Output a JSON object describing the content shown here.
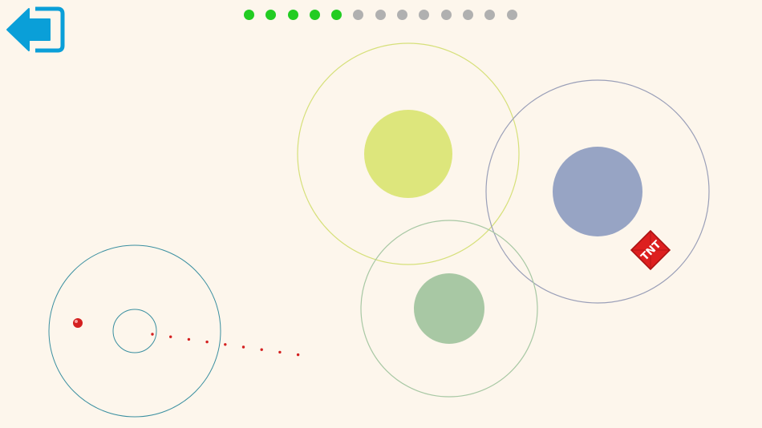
{
  "level_progress": {
    "completed": 5,
    "total": 13,
    "completed_color": "#22cc22",
    "pending_color": "#b0b0b0"
  },
  "back_button": {
    "icon": "exit-arrow-icon",
    "color": "#0a9fd8"
  },
  "tnt": {
    "label": "TNT",
    "color": "#dd1f1f"
  },
  "colors": {
    "background": "#fdf6ec",
    "ball": "#d42020",
    "aim_dots": "#d42020",
    "start_orbit": "#3a8fa0",
    "planet_yellow": "#dde67c",
    "planet_blue": "#97a4c4",
    "planet_green": "#a8c8a4"
  }
}
